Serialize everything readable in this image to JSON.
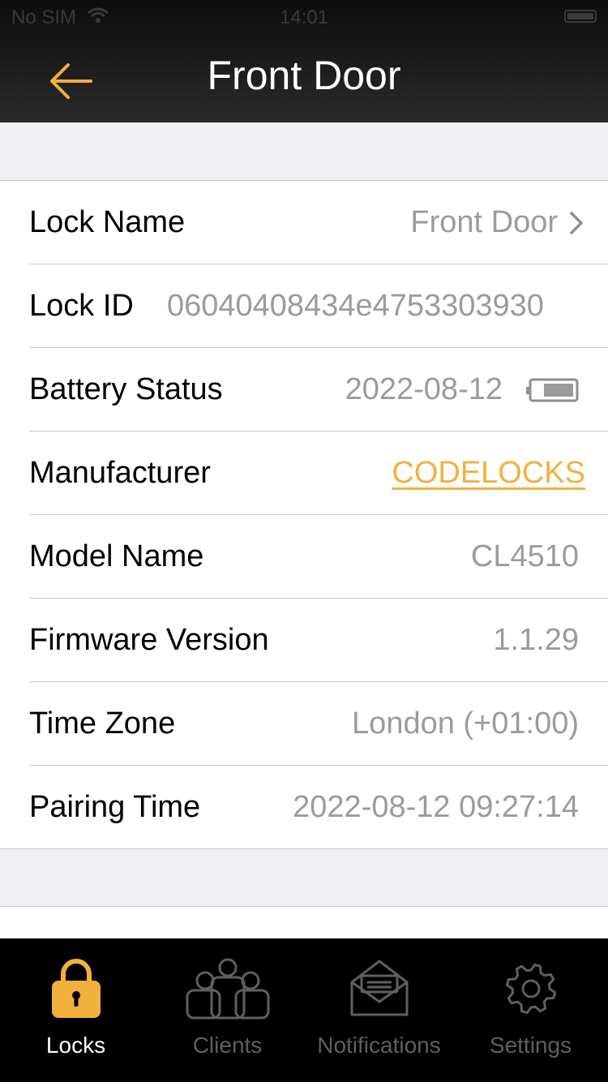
{
  "status_bar": {
    "carrier": "No SIM",
    "time": "14:01"
  },
  "header": {
    "title": "Front Door"
  },
  "details": {
    "rows": [
      {
        "label": "Lock Name",
        "value": "Front Door"
      },
      {
        "label": "Lock ID",
        "value": "06040408434e4753303930"
      },
      {
        "label": "Battery Status",
        "value": "2022-08-12",
        "battery_level": 0.75
      },
      {
        "label": "Manufacturer",
        "value": "CODELOCKS"
      },
      {
        "label": "Model Name",
        "value": "CL4510"
      },
      {
        "label": "Firmware Version",
        "value": "1.1.29"
      },
      {
        "label": "Time Zone",
        "value": "London (+01:00)"
      },
      {
        "label": "Pairing Time",
        "value": "2022-08-12 09:27:14"
      }
    ]
  },
  "tabs": [
    {
      "label": "Locks",
      "icon": "lock-icon",
      "active": true
    },
    {
      "label": "Clients",
      "icon": "clients-icon",
      "active": false
    },
    {
      "label": "Notifications",
      "icon": "notifications-icon",
      "active": false
    },
    {
      "label": "Settings",
      "icon": "settings-icon",
      "active": false
    }
  ],
  "colors": {
    "accent": "#f2b13c",
    "tab_inactive": "#5f5f5f",
    "value_gray": "#9b9b9b"
  }
}
